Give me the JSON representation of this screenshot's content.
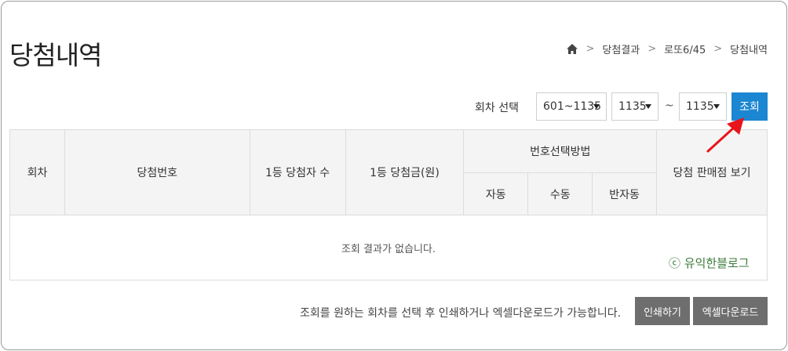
{
  "page": {
    "title": "당첨내역"
  },
  "breadcrumb": {
    "items": [
      "당첨결과",
      "로또6/45",
      "당첨내역"
    ]
  },
  "filter": {
    "label": "회차 선택",
    "range_select": "601~1135",
    "from_select": "1135",
    "tilde": "~",
    "to_select": "1135",
    "search_label": "조회"
  },
  "table": {
    "headers": {
      "round": "회차",
      "numbers": "당첨번호",
      "winners": "1등 당첨자 수",
      "prize": "1등 당첨금(원)",
      "method": "번호선택방법",
      "method_auto": "자동",
      "method_manual": "수동",
      "method_semi": "반자동",
      "store": "당첨 판매점 보기"
    },
    "empty_message": "조회 결과가 없습니다."
  },
  "watermark": "ⓒ 유익한블로그",
  "footer": {
    "hint": "조회를 원하는 회차를 선택 후 인쇄하거나 엑셀다운로드가 가능합니다.",
    "print_label": "인쇄하기",
    "excel_label": "엑셀다운로드"
  },
  "colors": {
    "primary": "#1b86d1",
    "secondary_btn": "#6e6e6e",
    "arrow": "#e8141b"
  }
}
